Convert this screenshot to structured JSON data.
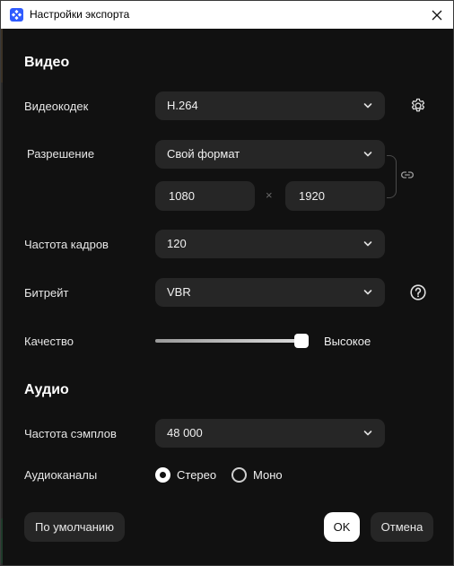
{
  "window": {
    "title": "Настройки экспорта"
  },
  "video": {
    "section_title": "Видео",
    "codec": {
      "label": "Видеокодек",
      "value": "H.264"
    },
    "resolution": {
      "label": "Разрешение",
      "preset": "Свой формат",
      "width": "1080",
      "separator": "×",
      "height": "1920"
    },
    "framerate": {
      "label": "Частота кадров",
      "value": "120"
    },
    "bitrate": {
      "label": "Битрейт",
      "value": "VBR"
    },
    "quality": {
      "label": "Качество",
      "value_label": "Высокое",
      "level": 0.99
    }
  },
  "audio": {
    "section_title": "Аудио",
    "samplerate": {
      "label": "Частота сэмплов",
      "value": "48 000"
    },
    "channels": {
      "label": "Аудиоканалы",
      "options": [
        {
          "label": "Стерео",
          "selected": true
        },
        {
          "label": "Моно",
          "selected": false
        }
      ]
    }
  },
  "buttons": {
    "defaults": "По умолчанию",
    "ok": "OK",
    "cancel": "Отмена"
  },
  "icons": {
    "app": "app-logo-icon",
    "close": "close-icon",
    "chevron": "chevron-down-icon",
    "settings": "gear-icon",
    "link": "link-icon",
    "help": "help-circle-icon"
  },
  "colors": {
    "background": "#111111",
    "control": "#262626",
    "accent": "#2f5bff",
    "primary_button": "#ffffff"
  }
}
